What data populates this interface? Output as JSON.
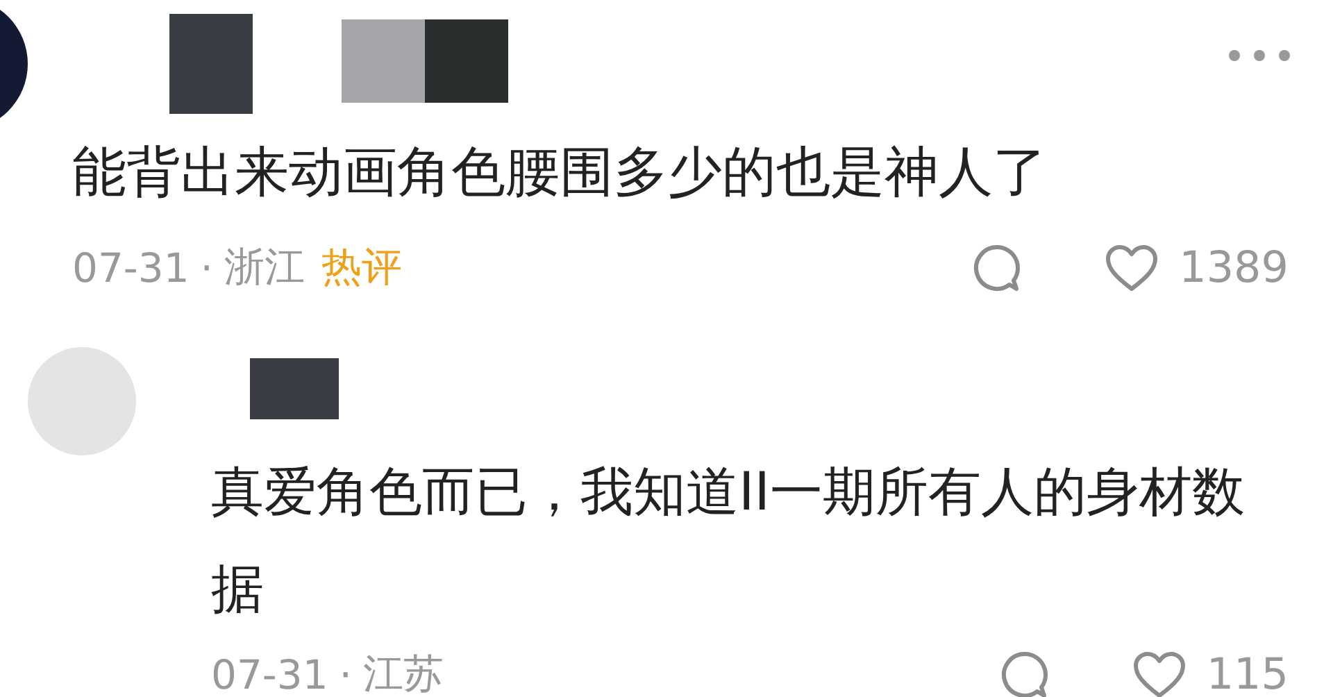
{
  "comments": [
    {
      "kind": "top",
      "text": "能背出来动画角色腰围多少的也是神人了",
      "date": "07-31",
      "separator": "·",
      "location": "浙江",
      "badge": "热评",
      "like_count": "1389"
    },
    {
      "kind": "reply",
      "text": "真爱角色而已，我知道II一期所有人的身材数据",
      "date": "07-31",
      "separator": "·",
      "location": "江苏",
      "like_count": "115"
    }
  ]
}
